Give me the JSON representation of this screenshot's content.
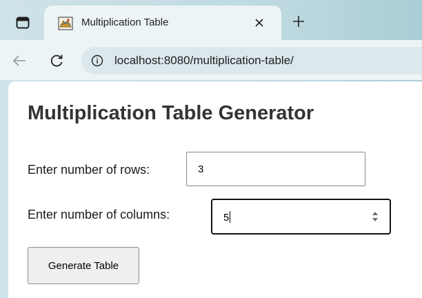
{
  "browser": {
    "tab": {
      "title": "Multiplication Table"
    },
    "address_bar": {
      "url": "localhost:8080/multiplication-table/"
    },
    "icons": [
      "tab-switcher-icon",
      "favicon-icon",
      "close-icon",
      "plus-icon",
      "back-arrow-icon",
      "reload-icon",
      "info-icon"
    ]
  },
  "page": {
    "title": "Multiplication Table Generator",
    "rows_label": "Enter number of rows:",
    "rows_value": "3",
    "cols_label": "Enter number of columns:",
    "cols_value": "5",
    "generate_button": "Generate Table"
  }
}
